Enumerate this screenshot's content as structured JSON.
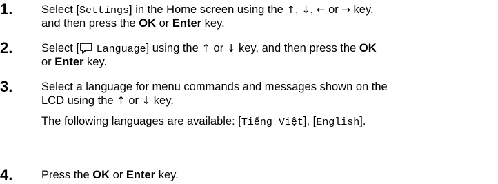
{
  "steps": [
    {
      "number": "1.",
      "l1": {
        "a": "Select [",
        "code": "Settings",
        "b": "] in the Home screen using the",
        "c": "or",
        "d": "key,"
      },
      "l2": {
        "a": "and then press the",
        "ok": "OK",
        "or": "or",
        "enter": "Enter",
        "b": "key."
      }
    },
    {
      "number": "2.",
      "l1": {
        "a": "Select [",
        "code": "Language",
        "b": "] using the",
        "c": "or",
        "d": "key, and then press the",
        "ok": "OK"
      },
      "l2": {
        "a": "or",
        "enter": "Enter",
        "b": "key."
      }
    },
    {
      "number": "3.",
      "l1": {
        "a": "Select a language for menu commands and messages shown on the"
      },
      "l2": {
        "a": "LCD using the",
        "c": "or",
        "d": "key."
      },
      "l3": {
        "a": "The following languages are available: [",
        "lang1": "Tiếng Việt",
        "sep": "], [",
        "lang2": "English",
        "b": "]."
      }
    },
    {
      "number": "4.",
      "l1": {
        "a": "Press the",
        "ok": "OK",
        "or": "or",
        "enter": "Enter",
        "b": "key."
      }
    }
  ],
  "icons": [
    "up-arrow-icon",
    "down-arrow-icon",
    "left-arrow-icon",
    "right-arrow-icon",
    "language-icon"
  ]
}
